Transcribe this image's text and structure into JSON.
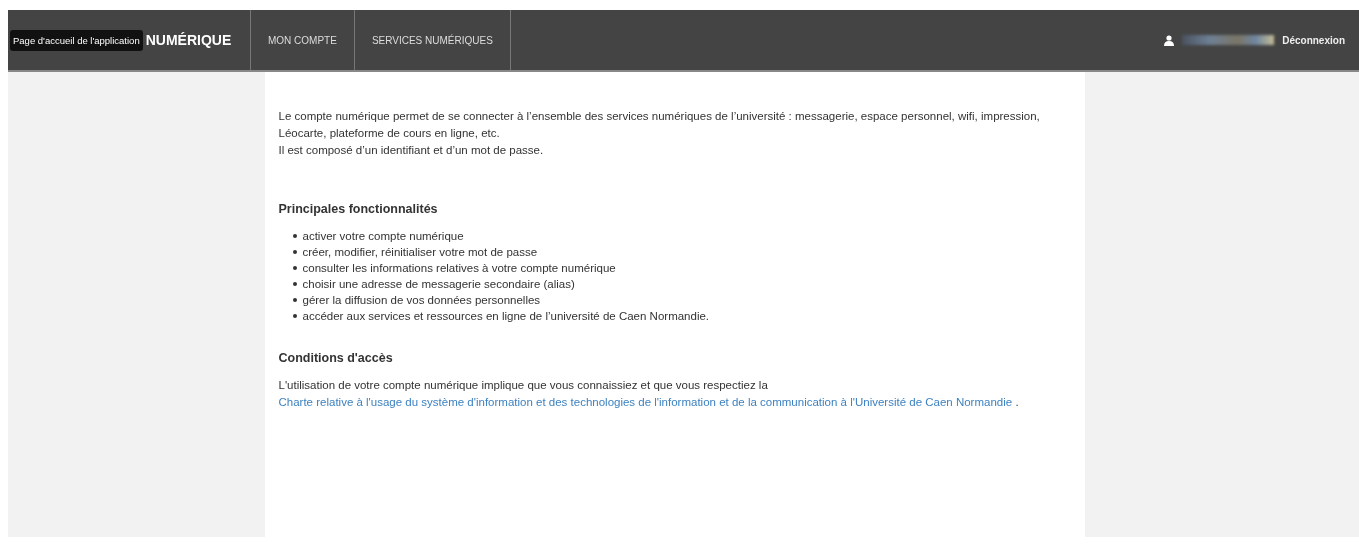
{
  "navbar": {
    "tooltip": "Page d'accueil de l'application",
    "brand": "NUMÉRIQUE",
    "menu": [
      {
        "label": "MON COMPTE",
        "selected": false
      },
      {
        "label": "SERVICES NUMÉRIQUES",
        "selected": false
      }
    ],
    "logout": "Déconnexion"
  },
  "content": {
    "intro": [
      "Le compte numérique permet de se connecter à l’ensemble des services numériques de l’université : messagerie, espace personnel, wifi, impression, Léocarte, plateforme de cours en ligne, etc.",
      "Il est composé d’un identifiant et d’un mot de passe."
    ],
    "features_title": "Principales fonctionnalités",
    "features": [
      "activer votre compte numérique",
      "créer, modifier, réinitialiser votre mot de passe",
      "consulter les informations relatives à votre compte numérique",
      "choisir une adresse de messagerie secondaire (alias)",
      "gérer la diffusion de vos données personnelles",
      "accéder aux services et ressources en ligne de l’université de Caen Normandie."
    ],
    "conditions_title": "Conditions d'accès",
    "conditions": {
      "text": "L'utilisation de votre compte numérique implique que vous connaissiez et que vous respectiez la",
      "link": "Charte relative à l'usage du système d'information et des technologies de l'information et de la communication à l'Université de Caen Normandie",
      "after": "."
    }
  }
}
